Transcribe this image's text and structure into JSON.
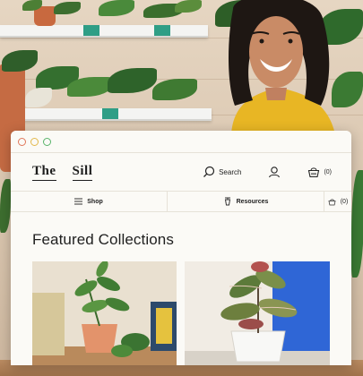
{
  "window": {
    "controls": [
      {
        "name": "close",
        "color": "#e0775a"
      },
      {
        "name": "minimize",
        "color": "#e2b84b"
      },
      {
        "name": "maximize",
        "color": "#58b36a"
      }
    ]
  },
  "header": {
    "logo": {
      "word1": "The",
      "word2": "Sill"
    },
    "search_label": "Search",
    "cart_count": "(0)"
  },
  "nav": {
    "shop_label": "Shop",
    "resources_label": "Resources",
    "cart_count": "(0)"
  },
  "main": {
    "section_title": "Featured Collections",
    "cards": [
      {
        "name": "collection-card-1",
        "icon": "potted-plant-image"
      },
      {
        "name": "collection-card-2",
        "icon": "rubber-plant-image"
      }
    ]
  },
  "colors": {
    "accent_shelf_tag": "#2f9e86",
    "top_blue": "#2f66d6",
    "shirt": "#e8b624"
  }
}
